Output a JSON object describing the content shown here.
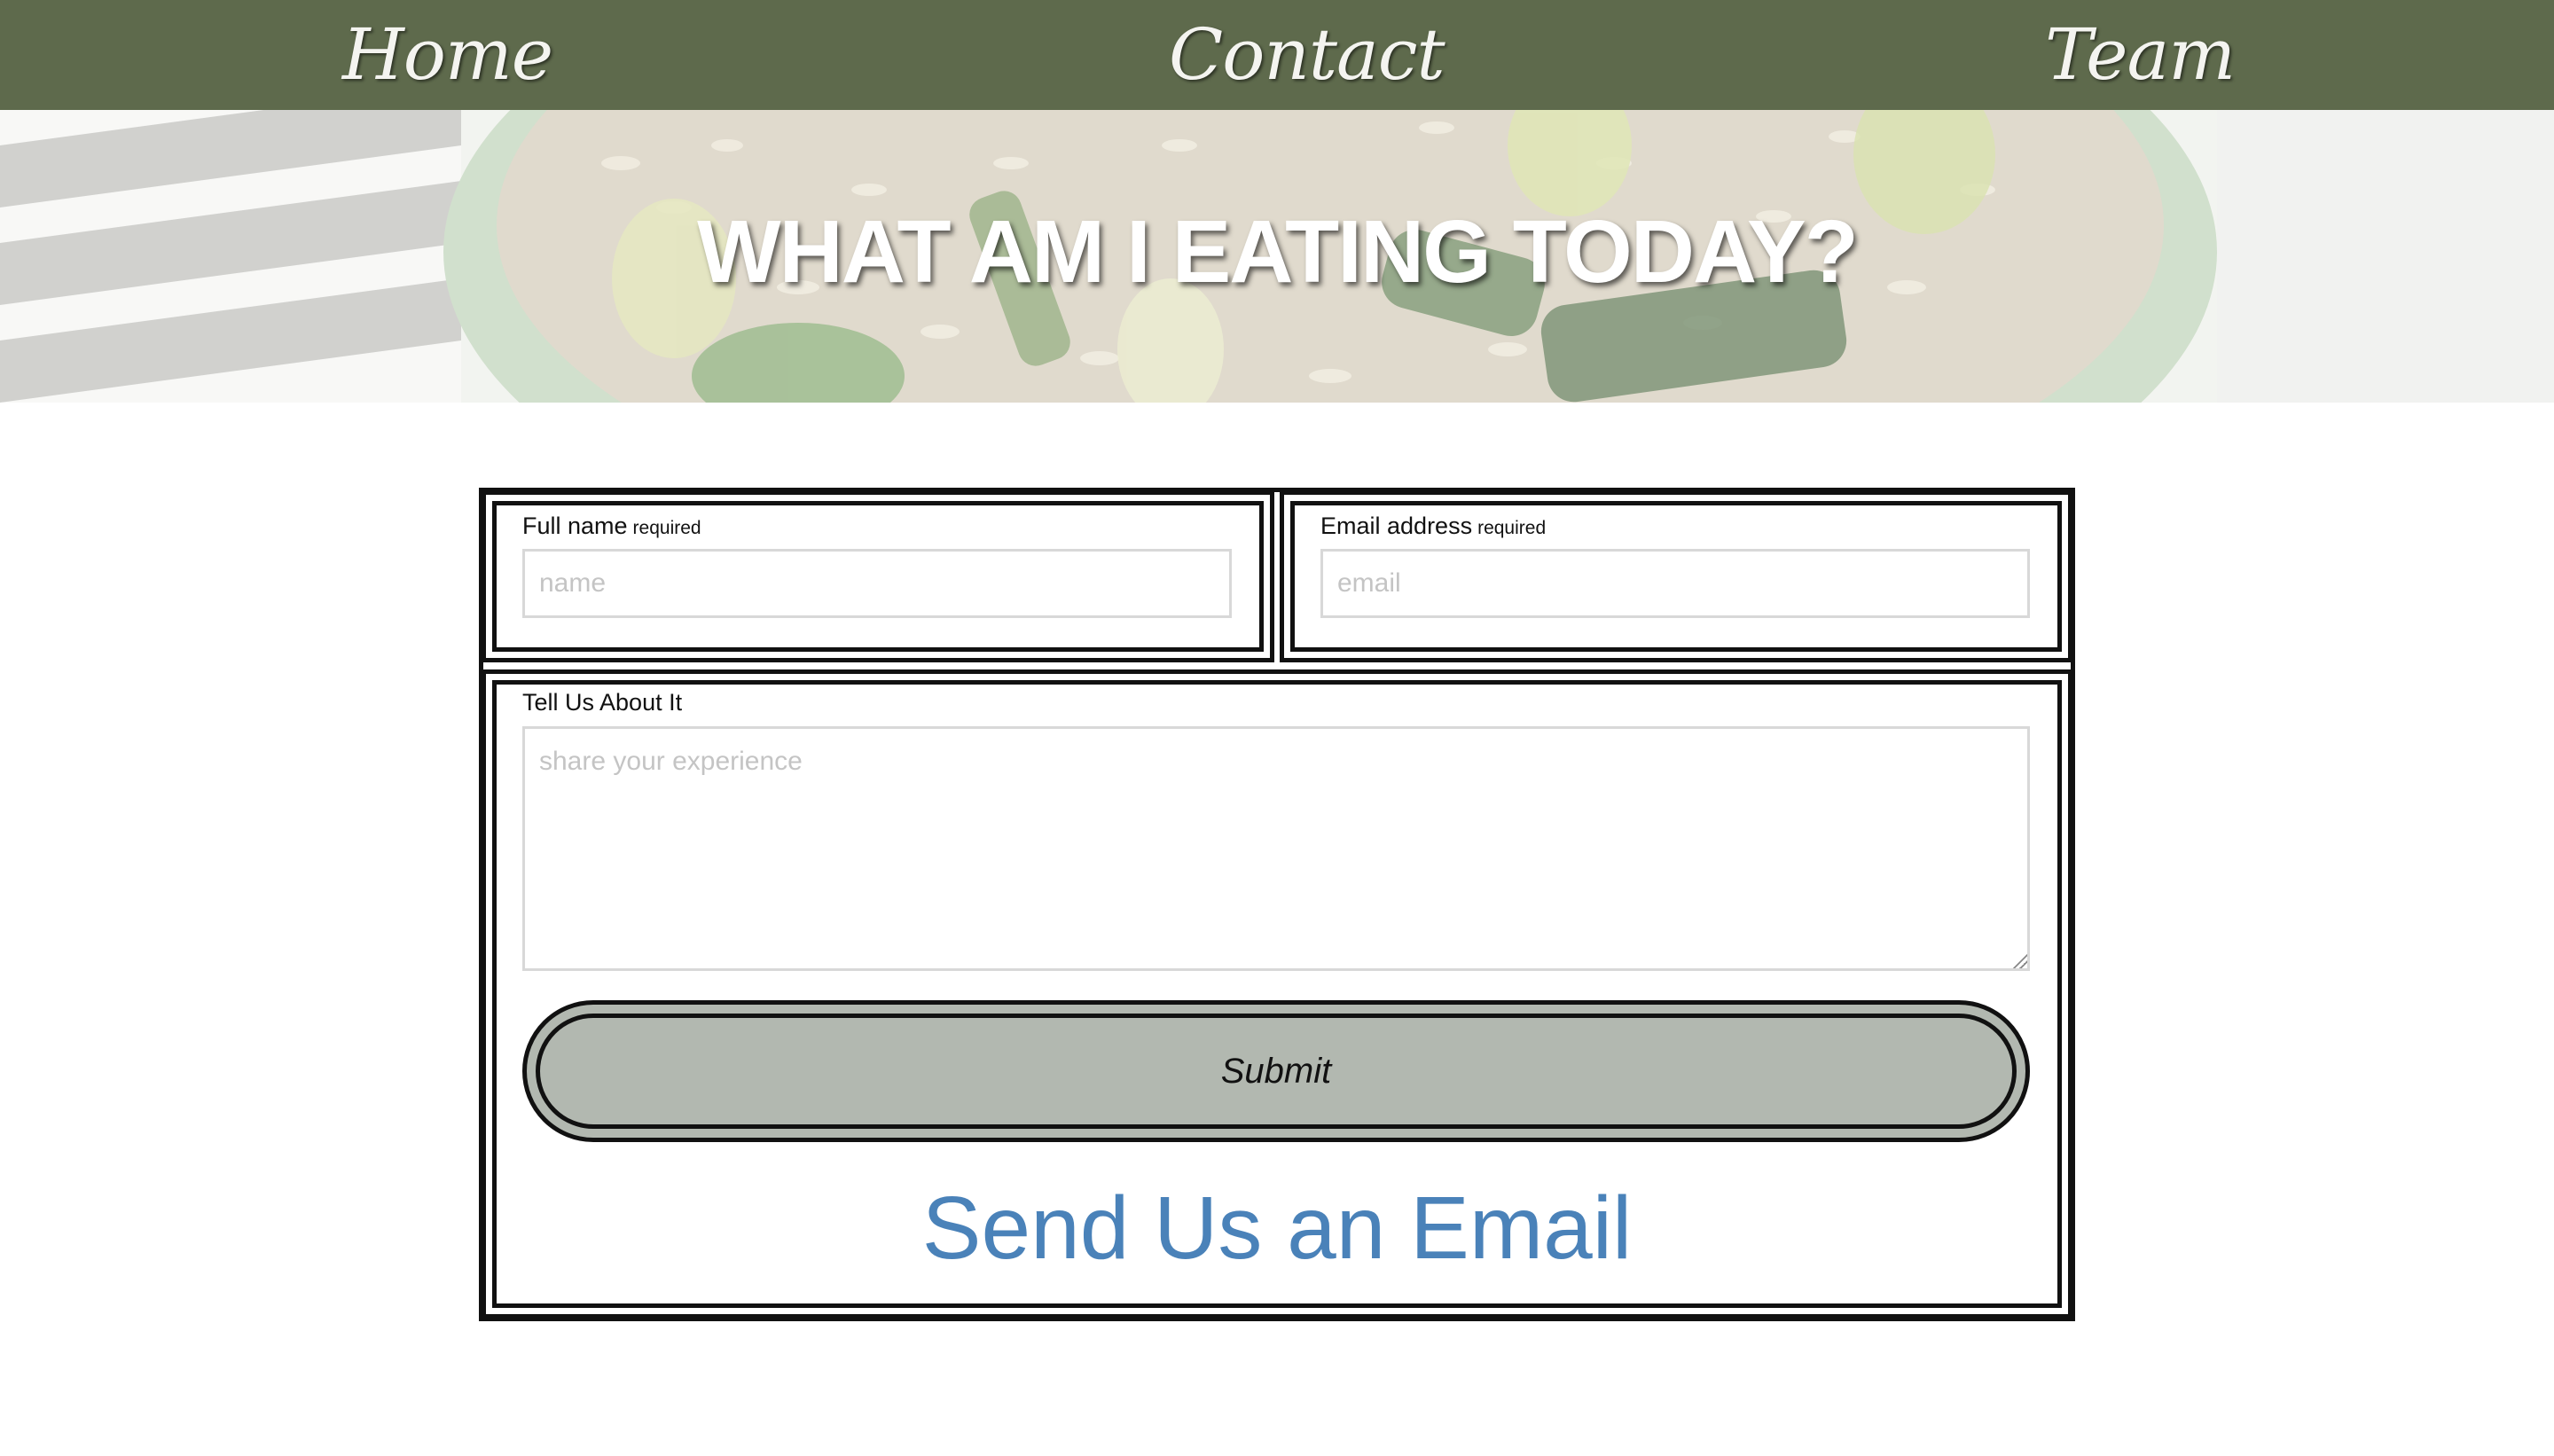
{
  "nav": {
    "items": [
      {
        "label": "Home"
      },
      {
        "label": "Contact"
      },
      {
        "label": "Team"
      }
    ]
  },
  "hero": {
    "title": "WHAT AM I EATING TODAY?"
  },
  "form": {
    "name": {
      "label": "Full name",
      "required_tag": "required",
      "placeholder": "name",
      "value": ""
    },
    "email": {
      "label": "Email address",
      "required_tag": "required",
      "placeholder": "email",
      "value": ""
    },
    "message": {
      "label": "Tell Us About It",
      "placeholder": "share your experience",
      "value": ""
    },
    "submit_label": "Submit",
    "email_link_label": "Send Us an Email"
  },
  "colors": {
    "nav_background": "#5e6a4c",
    "submit_background": "#b2b8b0",
    "email_link": "#4a82b9"
  }
}
